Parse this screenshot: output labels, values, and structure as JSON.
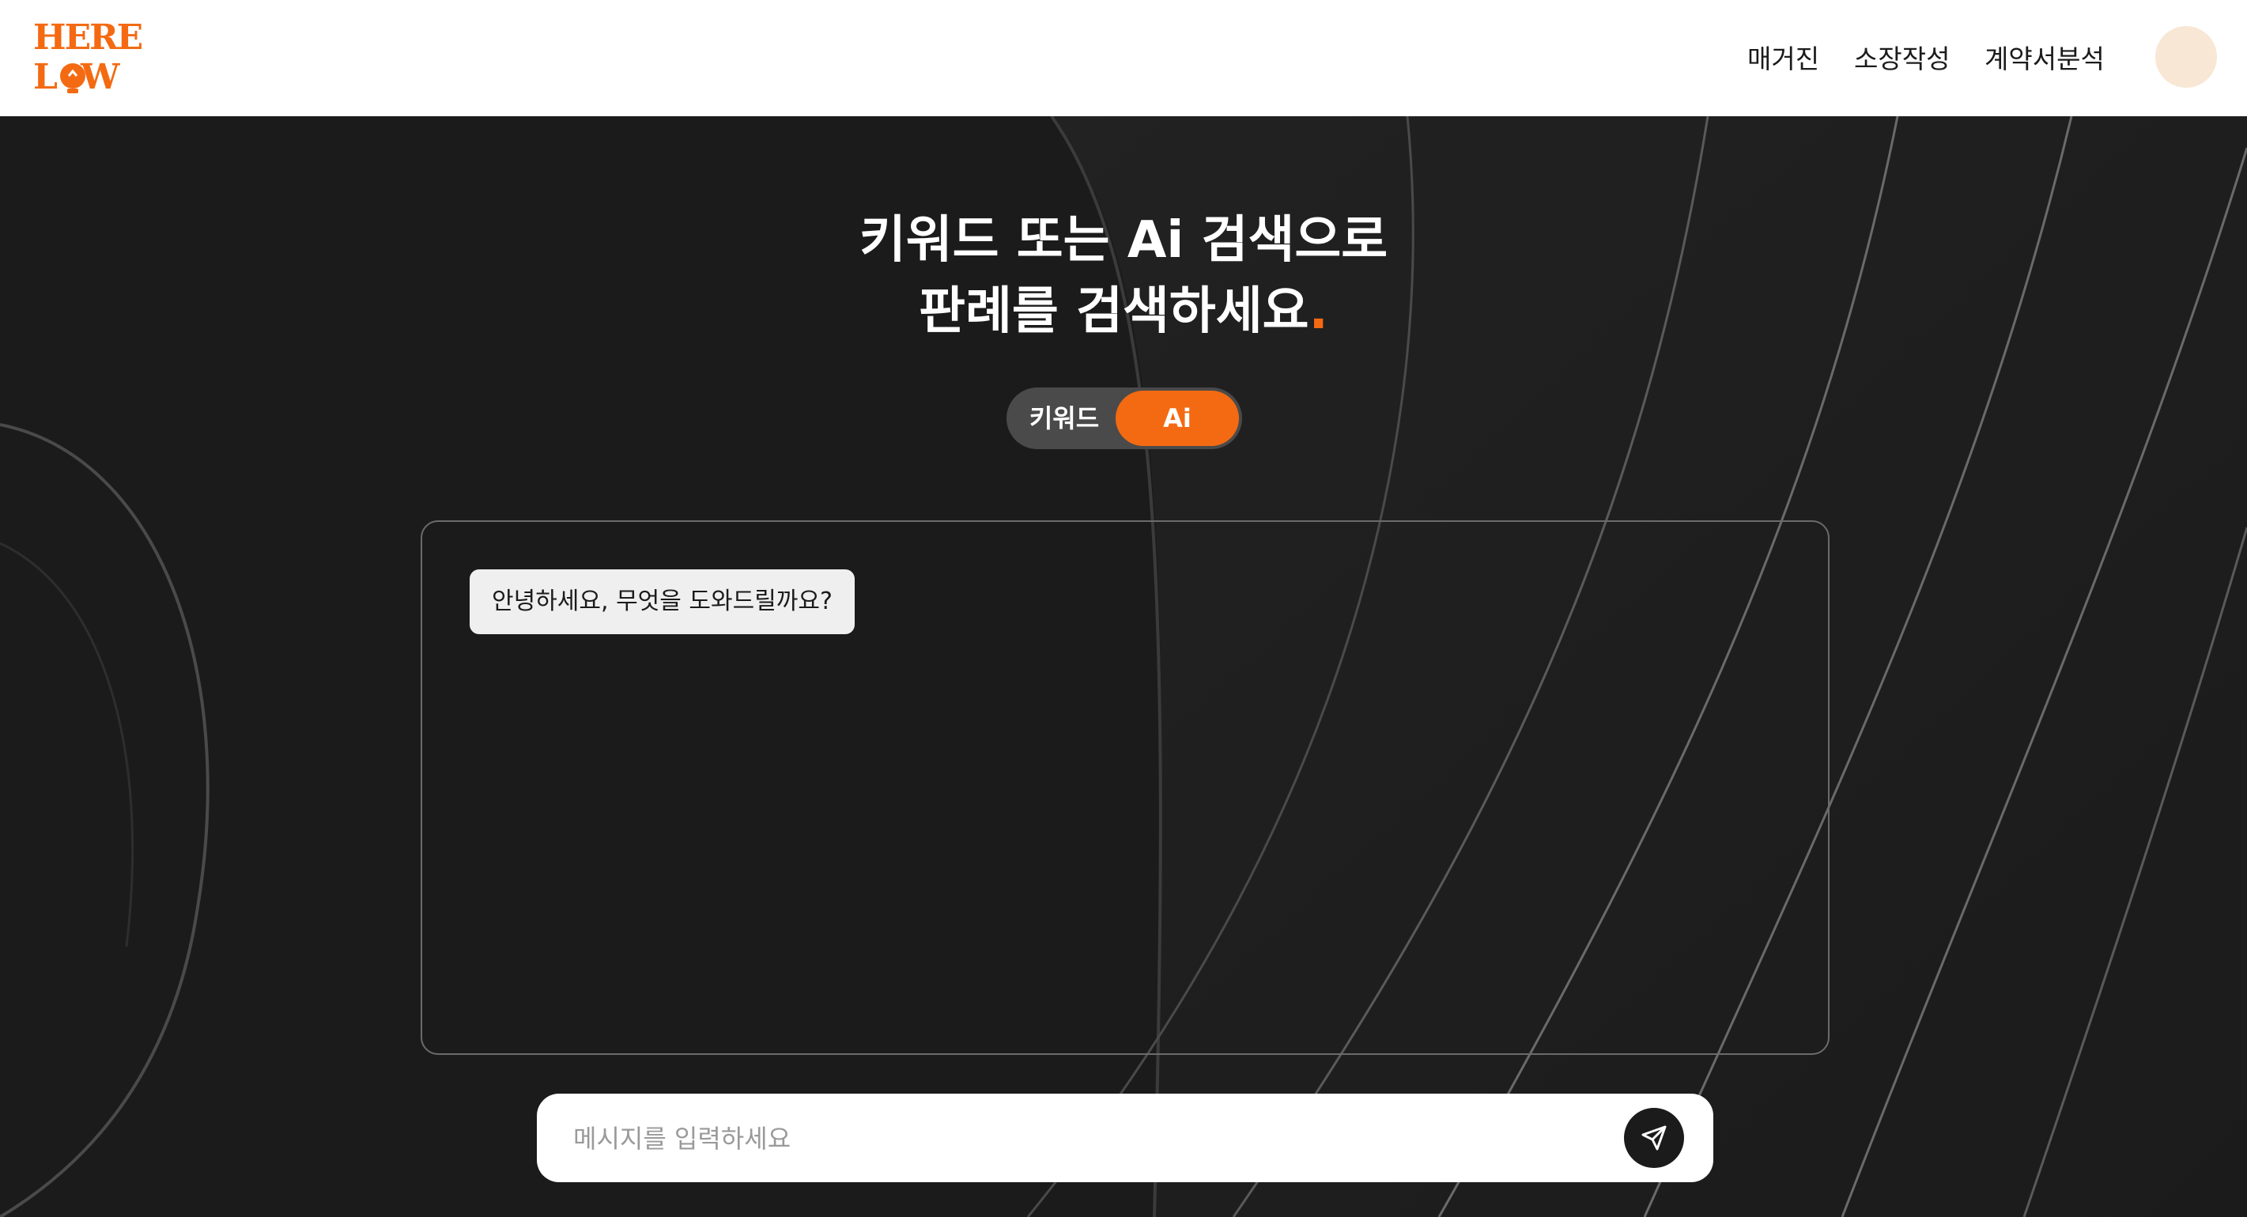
{
  "header": {
    "logo": {
      "line1": "HERE",
      "line2": "LAW"
    },
    "nav": [
      "매거진",
      "소장작성",
      "계약서분석"
    ]
  },
  "hero": {
    "headline_line1": "키워드 또는 Ai 검색으로",
    "headline_line2": "판례를 검색하세요",
    "headline_dot": "."
  },
  "toggle": {
    "keyword_label": "키워드",
    "ai_label": "Ai",
    "selected": "Ai"
  },
  "chat": {
    "messages": [
      "안녕하세요, 무엇을 도와드릴까요?"
    ]
  },
  "composer": {
    "placeholder": "메시지를 입력하세요",
    "value": ""
  },
  "colors": {
    "accent": "#f46a12",
    "background": "#1b1b1b",
    "header_bg": "#ffffff",
    "avatar": "#f8e7d4"
  },
  "icons": [
    "send-icon",
    "lightbulb-icon"
  ]
}
